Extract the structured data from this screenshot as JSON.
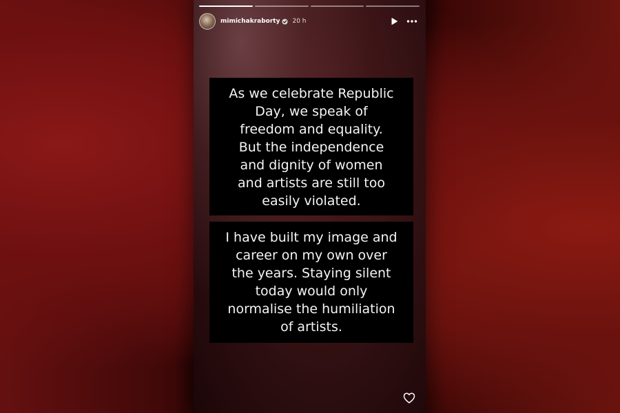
{
  "story": {
    "progress": [
      1,
      0,
      0,
      0
    ],
    "username": "mimichakraborty",
    "verified_icon": "verified-badge-icon",
    "time": "20 h",
    "header_icons": [
      "play-icon",
      "more-options-icon"
    ],
    "text_blocks": [
      "As we celebrate Republic\nDay, we speak of\nfreedom and equality.\nBut the independence\nand dignity of women\nand artists are still too\neasily violated.",
      "I have built my image and\ncareer on my own over\nthe years. Staying silent\ntoday would only\nnormalise the humiliation\nof artists."
    ],
    "like_icon": "heart-outline-icon"
  }
}
